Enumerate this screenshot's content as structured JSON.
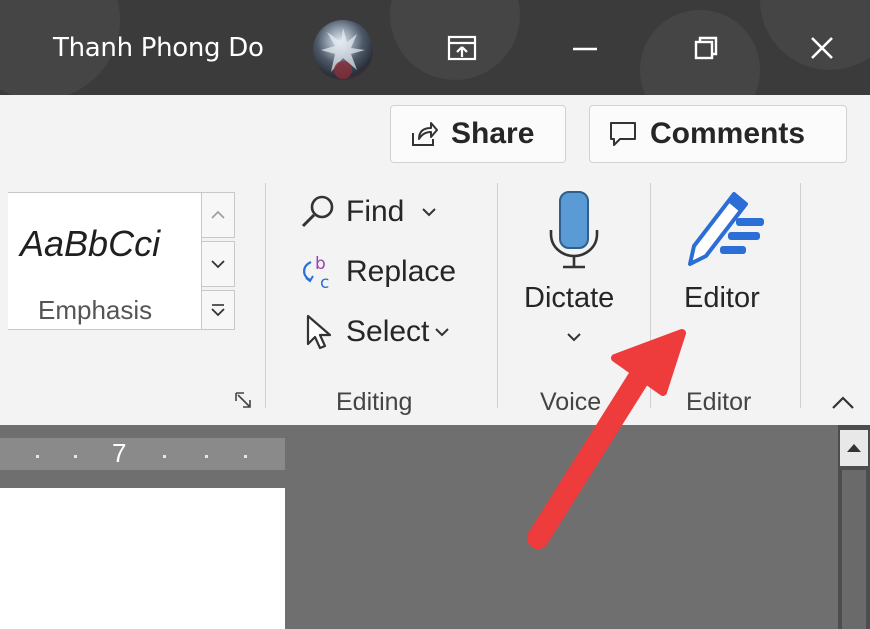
{
  "titlebar": {
    "user_name": "Thanh Phong Do",
    "icons": [
      "avatar",
      "ribbon-display-icon",
      "minimize-icon",
      "restore-icon",
      "close-icon"
    ]
  },
  "toolbar": {
    "share_label": "Share",
    "comments_label": "Comments"
  },
  "styles": {
    "sample_text": "AaBbCci",
    "style_name": "Emphasis"
  },
  "editing": {
    "find_label": "Find",
    "replace_label": "Replace",
    "select_label": "Select",
    "group_label": "Editing"
  },
  "voice": {
    "dictate_label": "Dictate",
    "group_label": "Voice"
  },
  "editor": {
    "button_label": "Editor",
    "group_label": "Editor"
  },
  "ruler": {
    "number": "7"
  },
  "colors": {
    "titlebar": "#3b3b3b",
    "ribbon": "#f3f3f3",
    "doc_background": "#6f6f6f",
    "mic": "#5b9bd5",
    "editor_pen": "#2b6fd6",
    "annotation_arrow": "#ee3b3b"
  }
}
